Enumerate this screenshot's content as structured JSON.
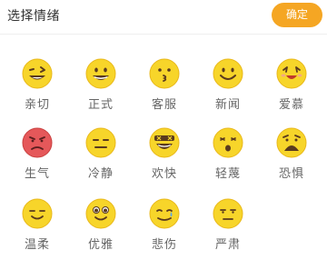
{
  "header": {
    "title": "选择情绪",
    "confirm_label": "确定"
  },
  "colors": {
    "accent": "#f5a623",
    "face_yellow": "#f7d52a",
    "face_red": "#e5585a",
    "feature_dark": "#5a3a1e"
  },
  "emotions": [
    {
      "label": "亲切",
      "icon": "winking-smile-icon"
    },
    {
      "label": "正式",
      "icon": "grin-icon"
    },
    {
      "label": "客服",
      "icon": "kissing-icon"
    },
    {
      "label": "新闻",
      "icon": "smiling-face-icon"
    },
    {
      "label": "爱慕",
      "icon": "heart-eyes-icon"
    },
    {
      "label": "生气",
      "icon": "angry-face-icon"
    },
    {
      "label": "冷静",
      "icon": "neutral-face-icon"
    },
    {
      "label": "欢快",
      "icon": "laughing-face-icon"
    },
    {
      "label": "轻蔑",
      "icon": "surprised-face-icon"
    },
    {
      "label": "恐惧",
      "icon": "fearful-face-icon"
    },
    {
      "label": "温柔",
      "icon": "gentle-smile-icon"
    },
    {
      "label": "优雅",
      "icon": "elegant-face-icon"
    },
    {
      "label": "悲伤",
      "icon": "sad-tear-icon"
    },
    {
      "label": "严肃",
      "icon": "serious-face-icon"
    }
  ]
}
